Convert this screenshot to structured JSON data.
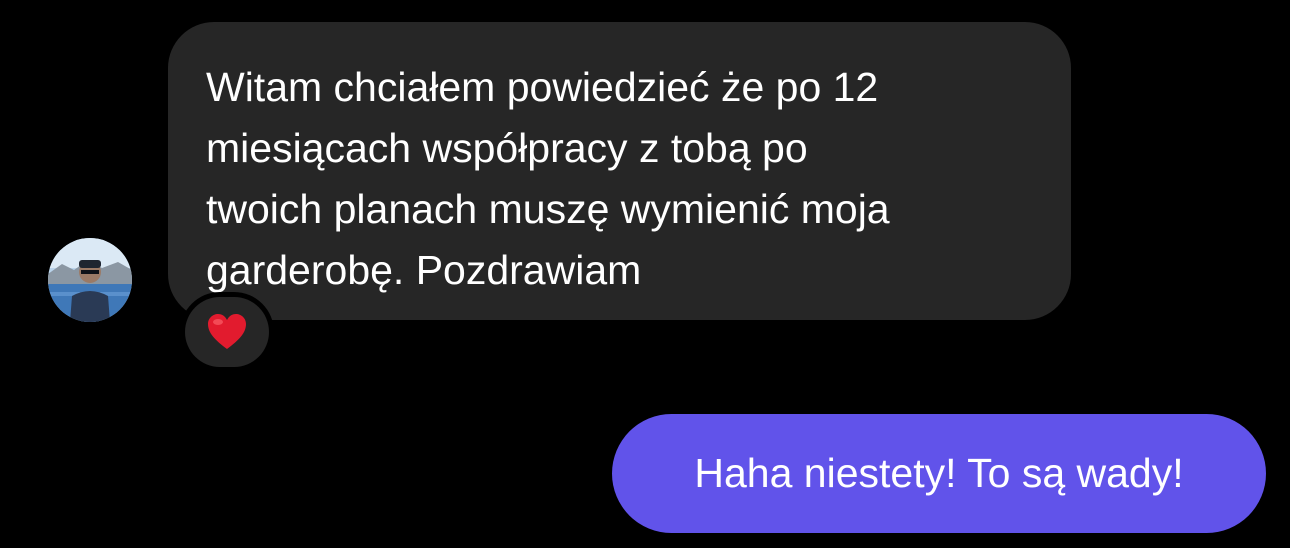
{
  "thread": {
    "incoming_message": {
      "lines": [
        "Witam chciałem powiedzieć że po 12",
        "miesiącach współpracy z tobą po",
        "twoich planach muszę wymienić moja",
        "garderobę. Pozdrawiam"
      ],
      "reaction_icon": "red-heart-icon"
    },
    "outgoing_message": {
      "text": "Haha niestety! To są wady!"
    }
  },
  "colors": {
    "background": "#000000",
    "incoming_bubble": "#262626",
    "outgoing_bubble": "#6153ea",
    "text": "#ffffff",
    "heart": "#e21b2e"
  }
}
